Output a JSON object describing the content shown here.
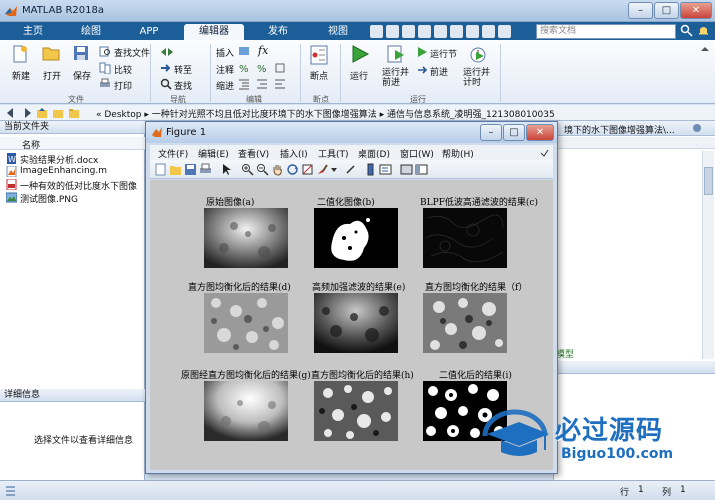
{
  "window": {
    "title": "MATLAB R2018a",
    "min": "–",
    "max": "□",
    "close": "✕"
  },
  "tabs": [
    {
      "label": "主页"
    },
    {
      "label": "绘图"
    },
    {
      "label": "APP"
    },
    {
      "label": "编辑器",
      "active": true
    },
    {
      "label": "发布"
    },
    {
      "label": "视图"
    }
  ],
  "search": {
    "placeholder": "搜索文档"
  },
  "ribbon": {
    "new": "新建",
    "open": "打开",
    "save": "保存",
    "find_files": "查找文件",
    "compare": "比较",
    "print": "打印",
    "goto": "转至",
    "find": "查找",
    "insert": "插入",
    "comment": "注释",
    "indent": "缩进",
    "fx": "fx",
    "breakpoints": "断点",
    "run": "运行",
    "run_advance": "运行并\n前进",
    "run_section": "运行节",
    "advance": "前进",
    "run_time": "运行并\n计时",
    "groups": {
      "file": "文件",
      "navigate": "导航",
      "edit": "编辑",
      "bp": "断点",
      "run": "运行"
    }
  },
  "address": {
    "path": "« Desktop ▸ 一种针对光照不均且低对比度环境下的水下图像增强算法 ▸ 通信与信息系统_凌明强_121308010035",
    "editor_tab_fragment": "境下的水下图像增强算法\\..."
  },
  "current_folder": {
    "title": "当前文件夹",
    "column": "名称",
    "files": [
      {
        "name": "实验结果分析.docx",
        "icon": "word-icon"
      },
      {
        "name": "ImageEnhancing.m",
        "icon": "m-file-icon"
      },
      {
        "name": "一种有效的低对比度水下图像",
        "icon": "pdf-icon"
      },
      {
        "name": "测试图像.PNG",
        "icon": "image-icon"
      }
    ]
  },
  "details": {
    "title": "详细信息",
    "hint": "选择文件以查看详细信息"
  },
  "right_panel": {
    "fragment": "模型"
  },
  "figure": {
    "title": "Figure 1",
    "menu": [
      "文件(F)",
      "编辑(E)",
      "查看(V)",
      "插入(I)",
      "工具(T)",
      "桌面(D)",
      "窗口(W)",
      "帮助(H)"
    ],
    "panels": [
      {
        "caption": "原始图像(a)",
        "kind": "orig"
      },
      {
        "caption": "二值化图像(b)",
        "kind": "binary"
      },
      {
        "caption": "BLPF低波高通滤波的结果(c)",
        "kind": "dark"
      },
      {
        "caption": "直方图均衡化后的结果(d)",
        "kind": "gray-hist"
      },
      {
        "caption": "高频加强滤波的结果(e)",
        "kind": "dark-texture"
      },
      {
        "caption": "直方图均衡化的结果（f）",
        "kind": "gray-hist2"
      },
      {
        "caption": "原图经直方图均衡化后的结果(g)",
        "kind": "bright"
      },
      {
        "caption": "直方图均衡化后的结果(h)",
        "kind": "texture"
      },
      {
        "caption": "二值化后的结果(i)",
        "kind": "binary2"
      }
    ]
  },
  "status": {
    "row_label": "行",
    "row": "1",
    "col_label": "列",
    "col": "1"
  },
  "watermark": {
    "cn": "必过源码",
    "url": "Biguo100.com"
  }
}
